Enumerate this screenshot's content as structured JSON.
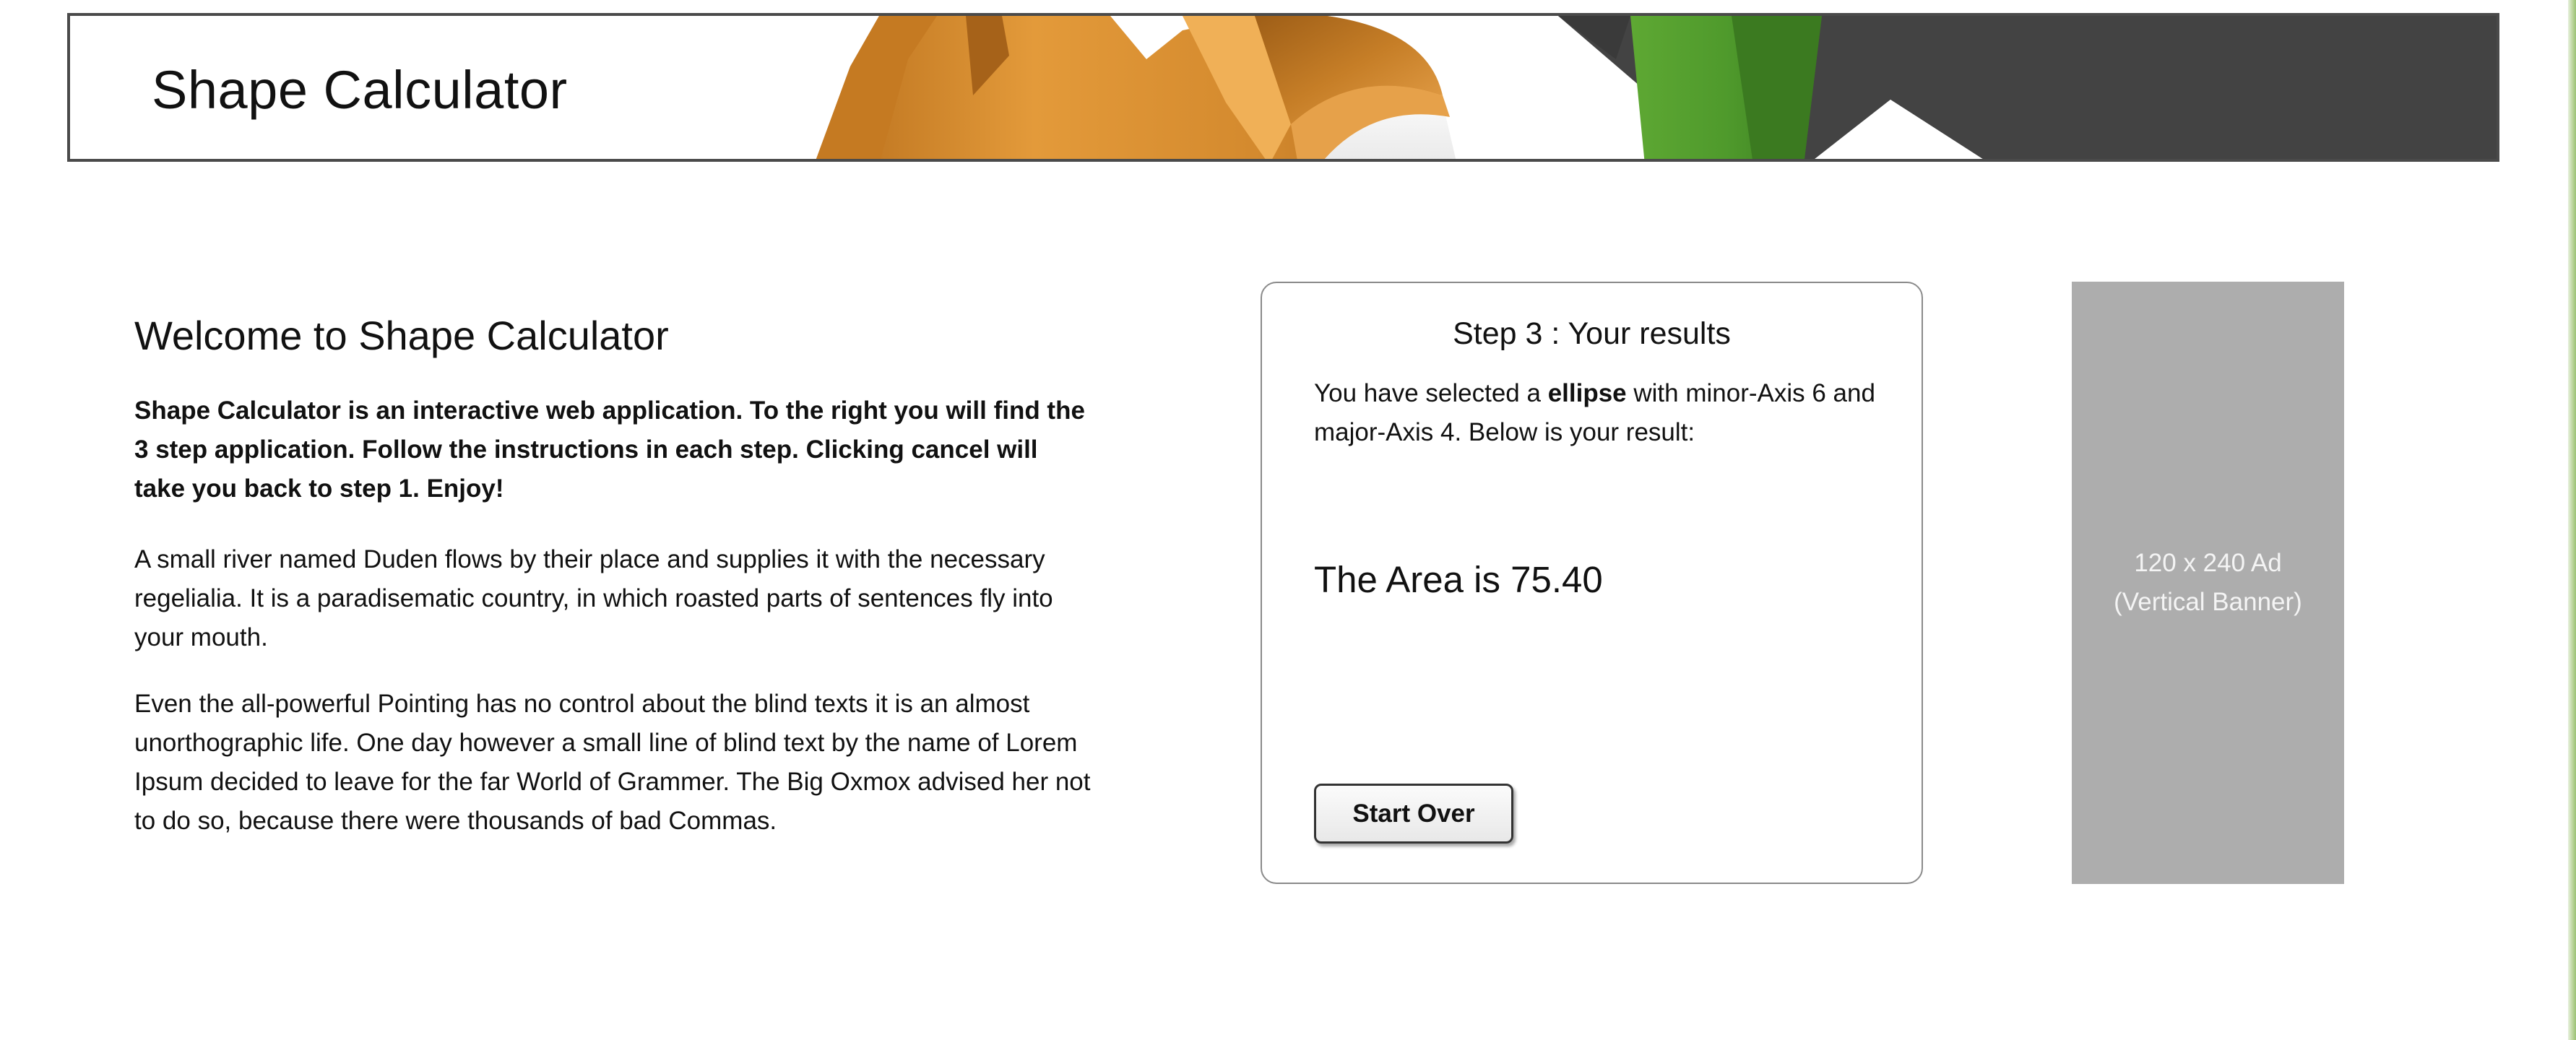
{
  "header": {
    "title": "Shape Calculator"
  },
  "intro": {
    "heading": "Welcome to Shape Calculator",
    "lead": "Shape Calculator is an interactive web application. To the right you will find the 3 step application. Follow the instructions in each step. Clicking cancel will take you back to step 1. Enjoy!",
    "paragraph_1": "A small river named Duden flows by their place and supplies it with the necessary regelialia. It is a paradisematic country, in which roasted parts of sentences fly into your mouth.",
    "paragraph_2": "Even the all-powerful Pointing has no control about the blind texts it is an almost unorthographic life. One day however a small line of blind text by the name of Lorem Ipsum decided to leave for the far World of Grammer. The Big Oxmox advised her not to do so, because there were thousands of bad Commas."
  },
  "results_card": {
    "title": "Step 3 : Your results",
    "desc_before": "You have selected a ",
    "shape": "ellipse",
    "desc_after": " with minor-Axis 6 and major-Axis 4. Below is your result:",
    "result": "The Area is 75.40",
    "start_over_label": "Start Over"
  },
  "ad": {
    "line_1": "120 x 240 Ad",
    "line_2": "(Vertical Banner)"
  },
  "colors": {
    "header_border": "#4a4a4a",
    "orange_shape": "#d48a2e",
    "green_shape": "#4f9a2c",
    "dark_panel": "#434343",
    "ad_background": "#adadad"
  },
  "icons": {
    "header_art": "3d-shapes-banner-art"
  }
}
